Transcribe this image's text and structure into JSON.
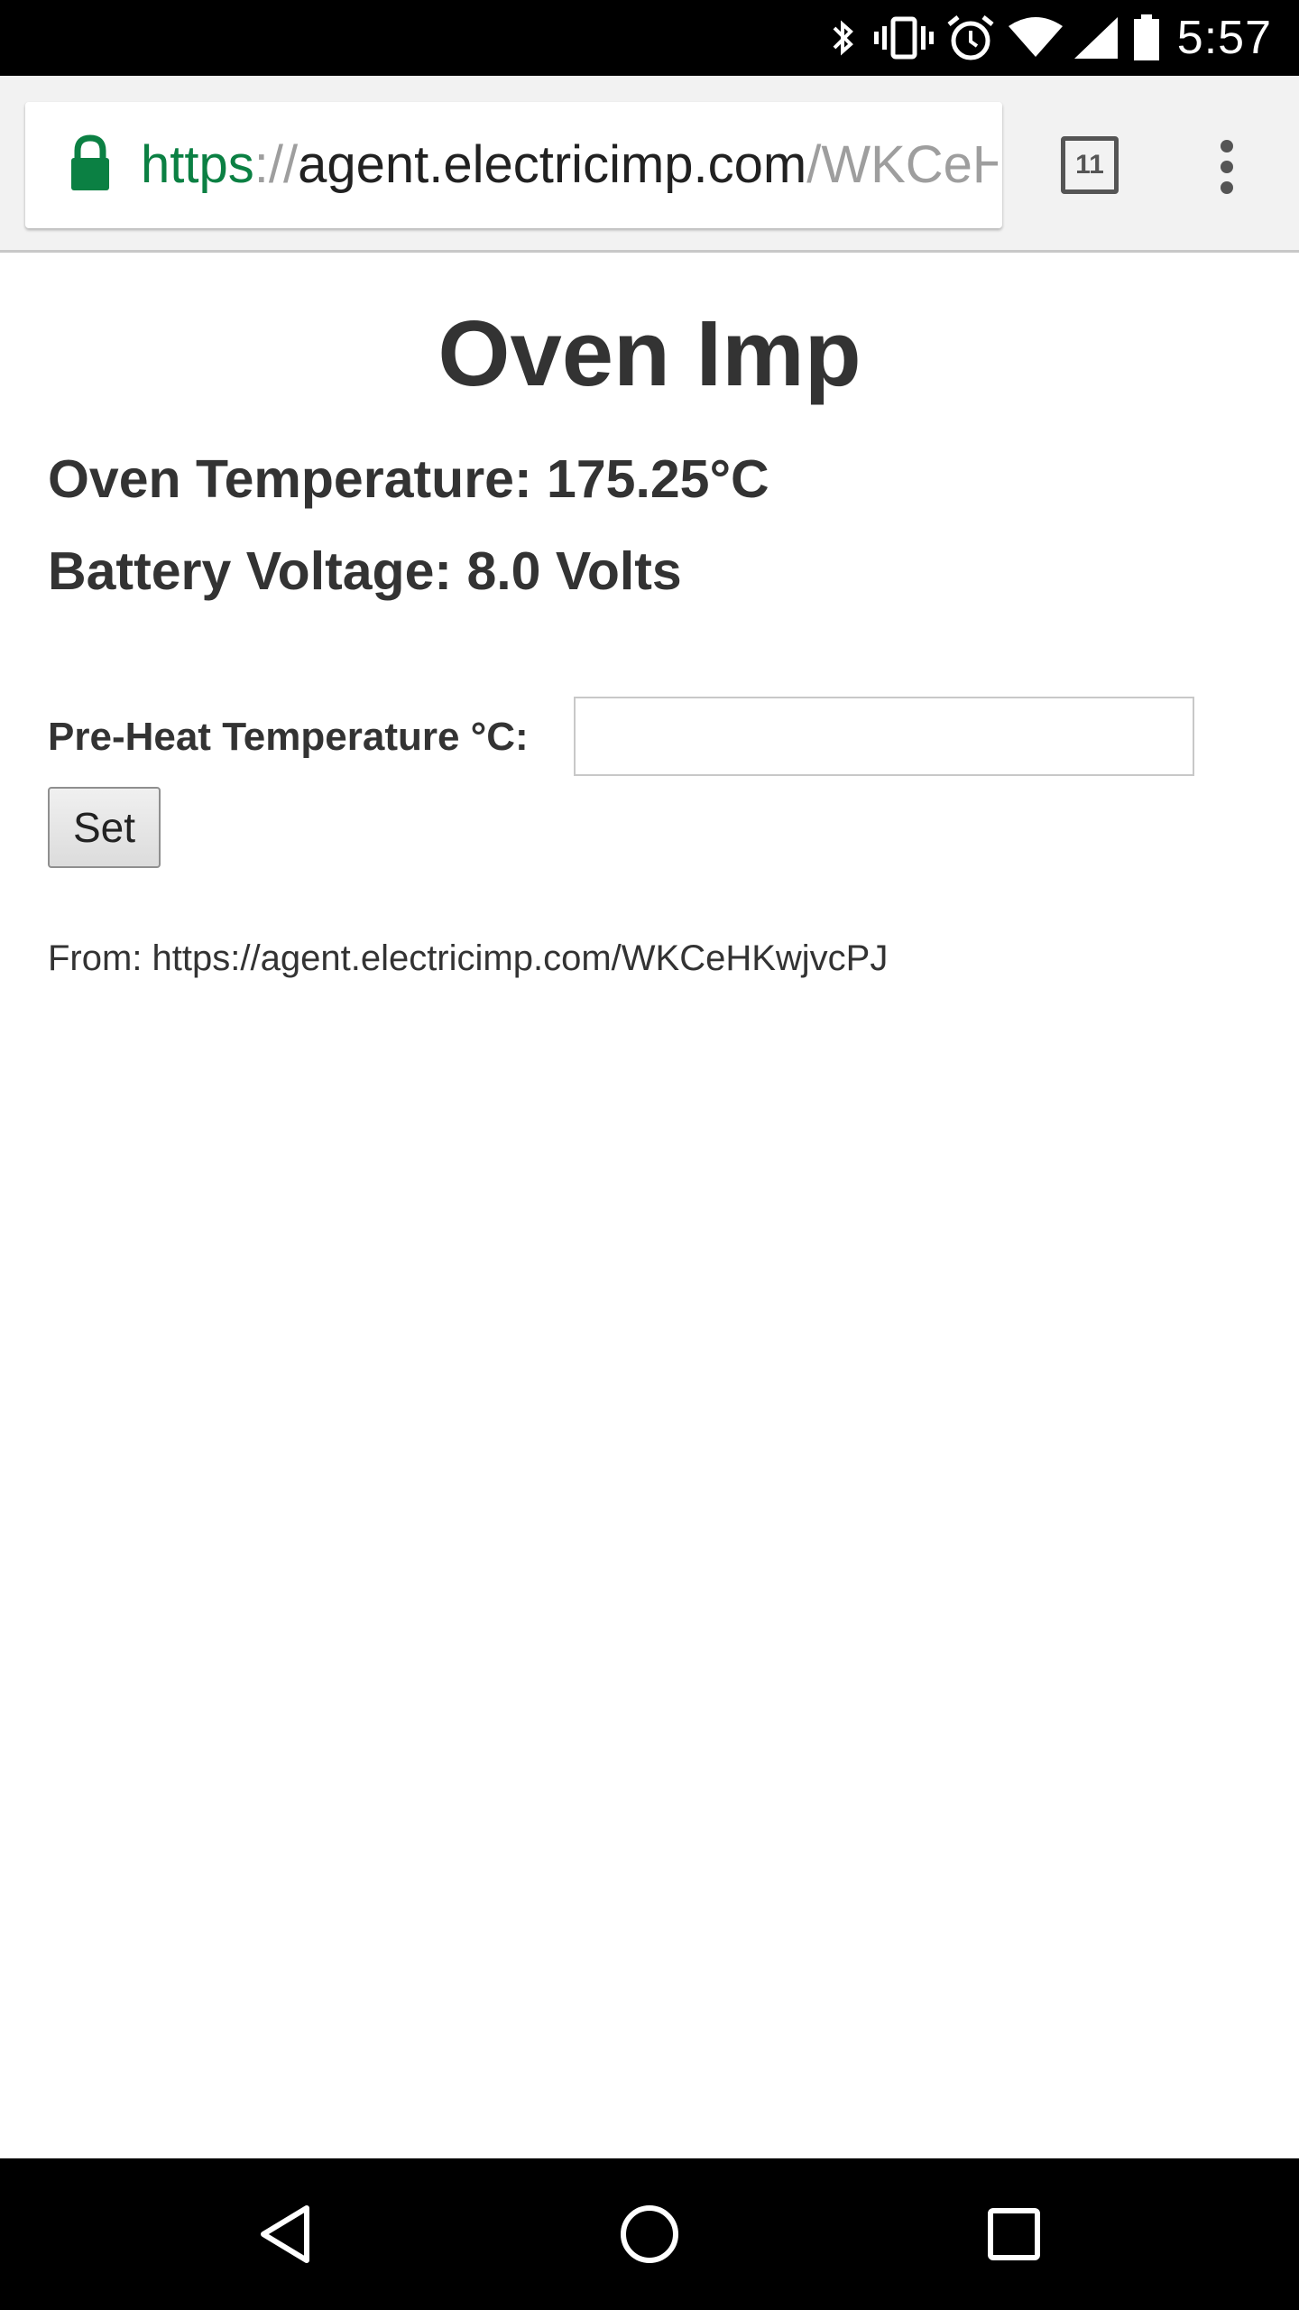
{
  "status_bar": {
    "time": "5:57",
    "icons": [
      "bluetooth-icon",
      "vibrate-icon",
      "alarm-icon",
      "wifi-icon",
      "cell-signal-icon",
      "battery-icon"
    ]
  },
  "browser": {
    "url": {
      "scheme": "https",
      "separator": "://",
      "host": "agent.electricimp.com",
      "path": "/WKCeH"
    },
    "tab_count": "11",
    "icons": [
      "lock-icon",
      "tab-switcher-icon",
      "more-vert-icon"
    ],
    "colors": {
      "secure_scheme": "#0b8043"
    }
  },
  "page": {
    "title": "Oven Imp",
    "oven_temperature": "Oven Temperature: 175.25°C",
    "battery_voltage": "Battery Voltage: 8.0 Volts",
    "preheat_label": "Pre-Heat Temperature °C:",
    "preheat_value": "",
    "set_label": "Set",
    "from_line": "From: https://agent.electricimp.com/WKCeHKwjvcPJ"
  },
  "nav_bar": {
    "icons": [
      "back-icon",
      "home-icon",
      "recents-icon"
    ]
  }
}
